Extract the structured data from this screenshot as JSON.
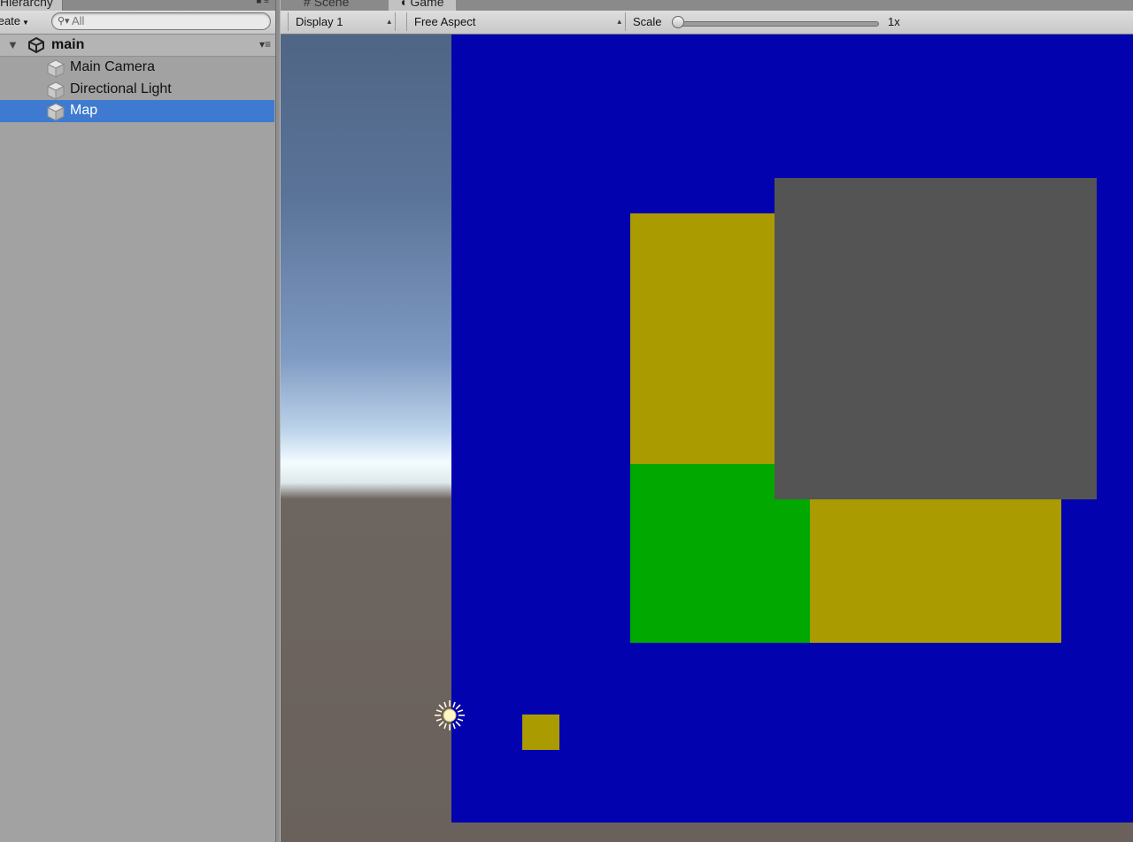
{
  "hierarchy": {
    "tab_label": "Hierarchy",
    "create_label": "Create",
    "search_placeholder": "All",
    "scene_name": "main",
    "items": [
      {
        "label": "Main Camera",
        "selected": false
      },
      {
        "label": "Directional Light",
        "selected": false
      },
      {
        "label": "Map",
        "selected": true
      }
    ]
  },
  "game_view": {
    "tabs": [
      {
        "label": "Scene"
      },
      {
        "label": "Game"
      }
    ],
    "display_value": "Display 1",
    "aspect_value": "Free Aspect",
    "scale_label": "Scale",
    "scale_value": "1x"
  },
  "colors": {
    "selection": "#3e7bd0",
    "map_background": "#0202ae",
    "yellow_tile": "#a99b00",
    "green_tile": "#00a800",
    "gray_tile": "#545454"
  },
  "icons": {
    "scene": "unity-logo-icon",
    "object": "gameobject-cube-icon",
    "light": "sun-icon"
  }
}
